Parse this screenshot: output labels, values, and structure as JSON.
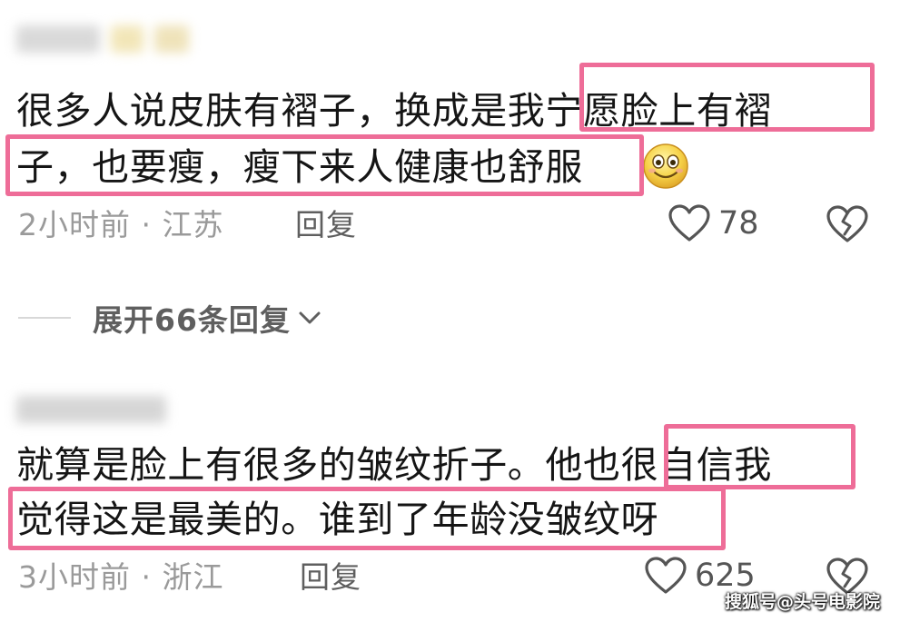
{
  "comments": [
    {
      "line1": "很多人说皮肤有褶子，换成是我宁愿脸上有褶",
      "line2": "子，也要瘦，瘦下来人健康也舒服",
      "time_location": "2小时前 · 江苏",
      "reply_label": "回复",
      "likes": "78",
      "emoji": "smiley-face-icon"
    },
    {
      "line1": "就算是脸上有很多的皱纹折子。他也很自信我",
      "line2": "觉得这是最美的。谁到了年龄没皱纹呀",
      "time_location": "3小时前 · 浙江",
      "reply_label": "回复",
      "likes": "625"
    }
  ],
  "expand_replies": {
    "label": "展开66条回复"
  },
  "watermark": "搜狐号@头号电影院",
  "colors": {
    "highlight_border": "#ee6d98",
    "meta_text": "#9a9a9a",
    "action_text": "#5f5f5f"
  }
}
